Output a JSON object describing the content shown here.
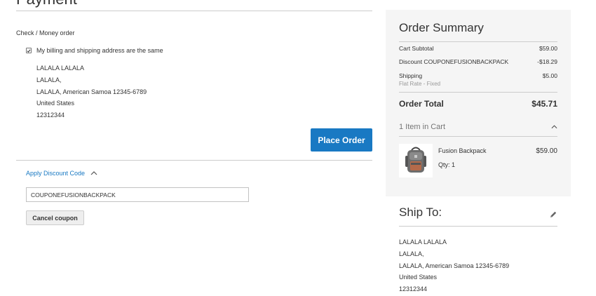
{
  "payment": {
    "title": "Payment",
    "method_label": "Check / Money order",
    "same_address_label": "My billing and shipping address are the same",
    "same_address_checked": true,
    "billing_address": [
      "LALALA LALALA",
      "LALALA,",
      "LALALA, American Samoa 12345-6789",
      "United States",
      "12312344"
    ],
    "place_order_label": "Place Order"
  },
  "discount": {
    "toggle_label": "Apply Discount Code",
    "input_value": "COUPONEFUSIONBACKPACK",
    "cancel_label": "Cancel coupon"
  },
  "summary": {
    "title": "Order Summary",
    "subtotal_label": "Cart Subtotal",
    "subtotal_value": "$59.00",
    "discount_label": "Discount COUPONEFUSIONBACKPACK",
    "discount_value": "-$18.29",
    "shipping_label": "Shipping",
    "shipping_method": "Flat Rate - Fixed",
    "shipping_value": "$5.00",
    "total_label": "Order Total",
    "total_value": "$45.71",
    "items_label": "1 Item in Cart",
    "item": {
      "name": "Fusion Backpack",
      "qty": "Qty: 1",
      "price": "$59.00"
    }
  },
  "ship_to": {
    "title": "Ship To:",
    "address": [
      "LALALA LALALA",
      "LALALA,",
      "LALALA, American Samoa 12345-6789",
      "United States",
      "12312344"
    ]
  },
  "colors": {
    "accent": "#1979c3",
    "summary_bg": "#f5f5f5"
  },
  "icons": {
    "collapse": "chevron-up-icon",
    "edit": "pencil-icon",
    "check": "checkmark-icon"
  }
}
